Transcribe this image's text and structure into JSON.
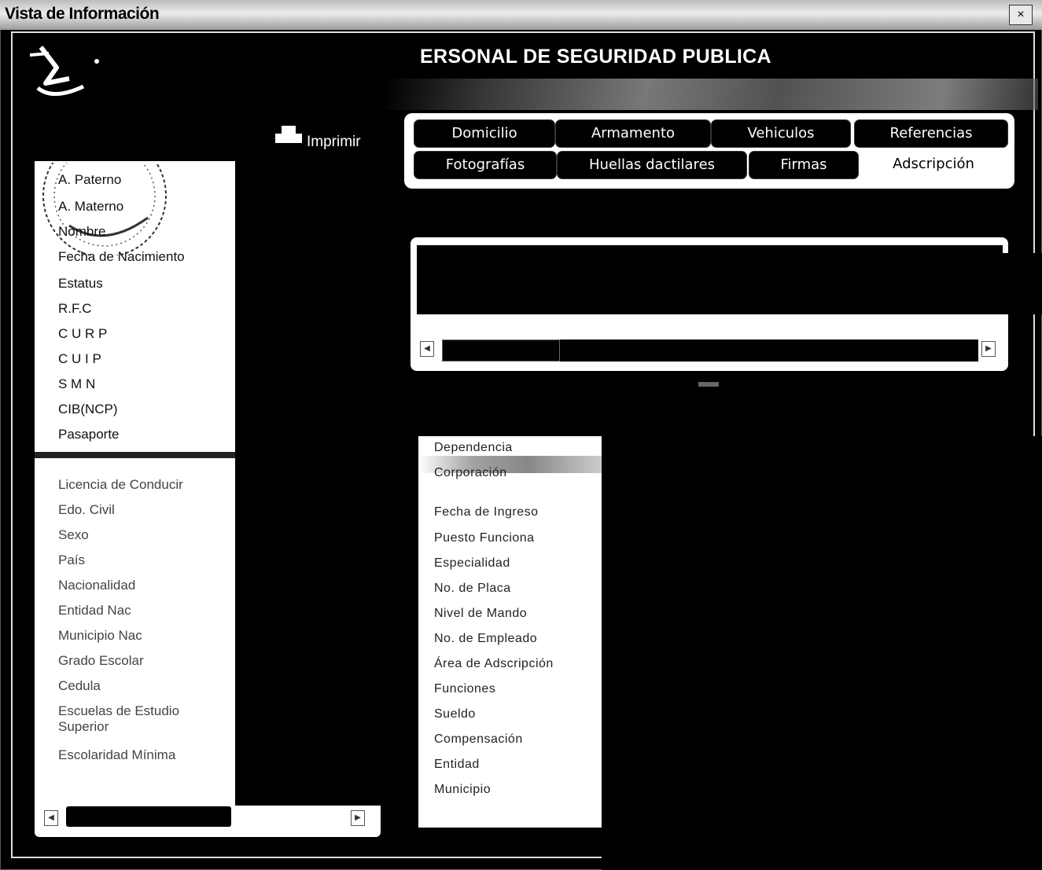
{
  "window": {
    "title": "Vista de Información",
    "close": "×"
  },
  "header": {
    "title": "ERSONAL DE SEGURIDAD PUBLICA",
    "print_label": "Imprimir"
  },
  "tabs": {
    "row1": [
      "Domicilio",
      "Armamento",
      "Vehiculos",
      "Referencias"
    ],
    "row2": [
      "Fotografías",
      "Huellas dactilares",
      "Firmas",
      "Adscripción"
    ],
    "active": "Adscripción"
  },
  "left_fields": [
    "A. Paterno",
    "A. Materno",
    "Nombre",
    "Fecha de Nacimiento",
    "Estatus",
    "R.F.C",
    "C U R P",
    "C U I P",
    "S M N",
    "CIB(NCP)",
    "Pasaporte",
    "Licencia de Conducir",
    "Edo. Civil",
    "Sexo",
    "País",
    "Nacionalidad",
    "Entidad Nac",
    "Municipio Nac",
    "Grado Escolar",
    "Cedula",
    "Escuelas de Estudio",
    "Superior",
    "Escolaridad Mínima"
  ],
  "adscripcion_fields": [
    "Dependencia",
    "Corporación",
    "Fecha de Ingreso",
    "Puesto Funciona",
    "Especialidad",
    "No. de Placa",
    "Nivel de Mando",
    "No. de Empleado",
    "Área de Adscripción",
    "Funciones",
    "Sueldo",
    "Compensación",
    "Entidad",
    "Municipio"
  ],
  "icons": {
    "logo": "agency-logo-icon",
    "seal": "mexico-seal-watermark",
    "print": "printer-icon"
  }
}
